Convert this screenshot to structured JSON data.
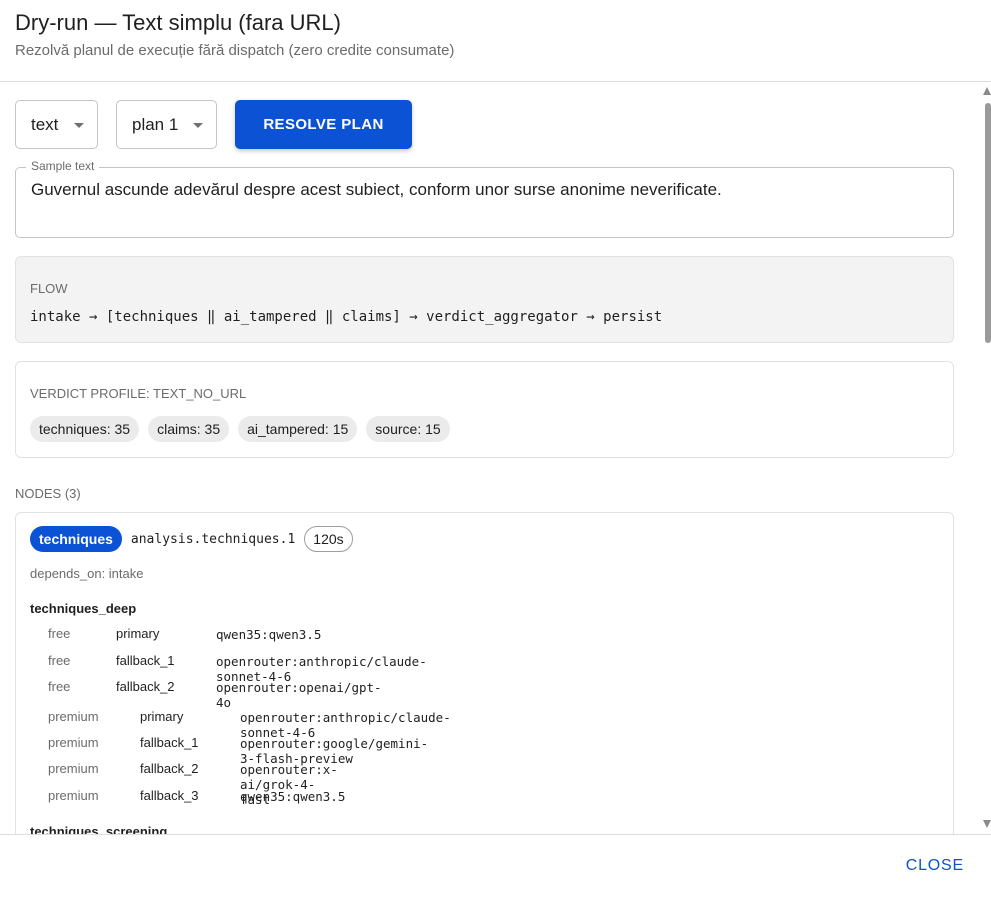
{
  "dialog": {
    "title": "Dry-run — Text simplu (fara URL)",
    "subtitle": "Rezolvă planul de execuție fără dispatch (zero credite consumate)"
  },
  "controls": {
    "mode_value": "text",
    "plan_value": "plan 1",
    "resolve_label": "RESOLVE PLAN"
  },
  "sample": {
    "label": "Sample text",
    "value": "Guvernul ascunde adevărul despre acest subiect, conform unor surse anonime neverificate."
  },
  "flow": {
    "label": "FLOW",
    "text": "intake → [techniques ‖ ai_tampered ‖ claims] → verdict_aggregator → persist"
  },
  "verdict": {
    "label": "VERDICT PROFILE: TEXT_NO_URL",
    "chips": [
      "techniques: 35",
      "claims: 35",
      "ai_tampered: 15",
      "source: 15"
    ]
  },
  "nodes": {
    "label": "NODES (3)",
    "items": [
      {
        "name": "techniques",
        "id": "analysis.techniques.1",
        "timeout": "120s",
        "depends_on": "depends_on: intake",
        "sections": [
          {
            "title": "techniques_deep",
            "free": [
              {
                "tier": "free",
                "role": "primary",
                "model": "qwen35:qwen3.5"
              },
              {
                "tier": "free",
                "role": "fallback_1",
                "model": "openrouter:anthropic/claude-sonnet-4-6"
              },
              {
                "tier": "free",
                "role": "fallback_2",
                "model": "openrouter:openai/gpt-4o"
              }
            ],
            "premium": [
              {
                "tier": "premium",
                "role": "primary",
                "model": "openrouter:anthropic/claude-sonnet-4-6"
              },
              {
                "tier": "premium",
                "role": "fallback_1",
                "model": "openrouter:google/gemini-3-flash-preview"
              },
              {
                "tier": "premium",
                "role": "fallback_2",
                "model": "openrouter:x-ai/grok-4-fast"
              },
              {
                "tier": "premium",
                "role": "fallback_3",
                "model": "qwen35:qwen3.5"
              }
            ]
          },
          {
            "title": "techniques_screening"
          }
        ]
      }
    ]
  },
  "footer": {
    "close_label": "CLOSE"
  },
  "colors": {
    "accent": "#0b53d4",
    "muted_text": "#6b6b6b",
    "chip_bg": "#ebebeb",
    "flow_bg": "#f3f3f3"
  }
}
